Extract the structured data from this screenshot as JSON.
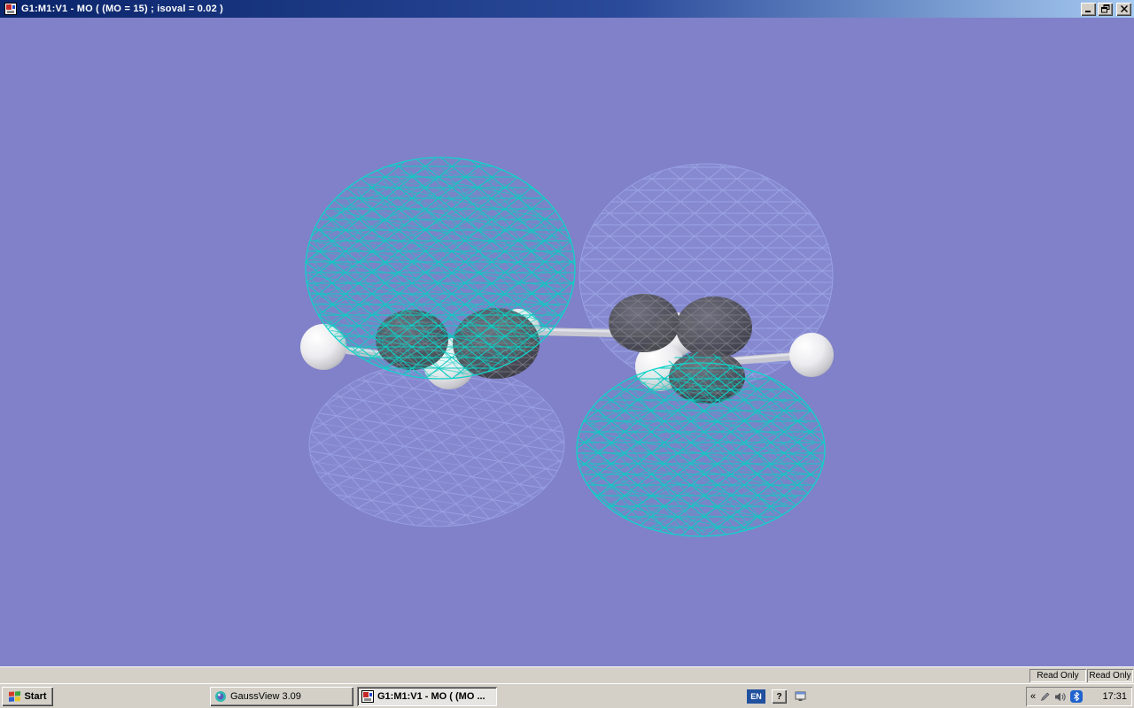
{
  "window": {
    "title": "G1:M1:V1 - MO ( (MO = 15) ; isoval = 0.02 )"
  },
  "viewport": {
    "mo_index": "15",
    "isovalue": "0.02",
    "colors": {
      "background": "#8081c8",
      "positive_phase_mesh": "#0cccc2",
      "negative_phase_mesh": "#9ea6e8",
      "inner_lobe_dark": "#3a3a42",
      "atom_sphere": "#e8e8ec",
      "bond": "#c8c8d2"
    }
  },
  "statusbar": {
    "read_only_left": "Read Only",
    "read_only_right": "Read Only"
  },
  "taskbar": {
    "start_label": "Start",
    "tasks": [
      {
        "label": "GaussView 3.09"
      },
      {
        "label": "G1:M1:V1 - MO ( (MO ..."
      }
    ],
    "tray": {
      "language_indicator": "EN",
      "help_label": "?",
      "collapse_chevron": "«",
      "clock": "17:31"
    }
  }
}
